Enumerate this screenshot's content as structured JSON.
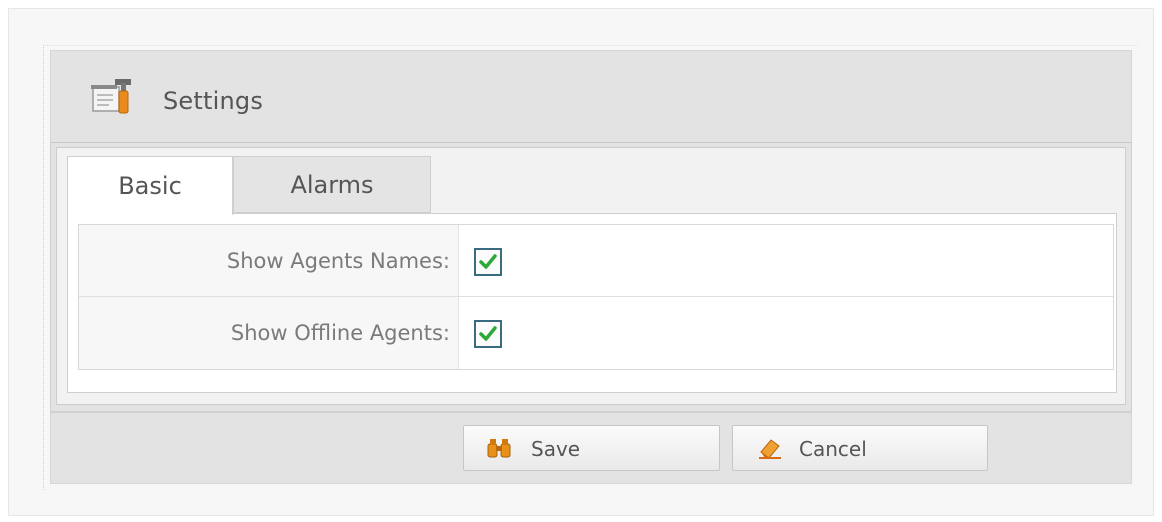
{
  "dialog": {
    "title": "Settings",
    "icon": "settings-tools-icon"
  },
  "tabs": [
    {
      "label": "Basic",
      "active": true
    },
    {
      "label": "Alarms",
      "active": false
    }
  ],
  "form": {
    "rows": [
      {
        "label": "Show Agents Names:",
        "checked": true
      },
      {
        "label": "Show Offline Agents:",
        "checked": true
      }
    ]
  },
  "buttons": {
    "save_label": "Save",
    "save_icon": "binoculars-icon",
    "cancel_label": "Cancel",
    "cancel_icon": "eraser-icon"
  },
  "colors": {
    "panel_bg": "#e3e3e3",
    "check_green": "#2fa83a",
    "checkbox_border": "#3a6b7f",
    "save_icon_color": "#e08a10",
    "cancel_icon_color": "#e0701a"
  }
}
